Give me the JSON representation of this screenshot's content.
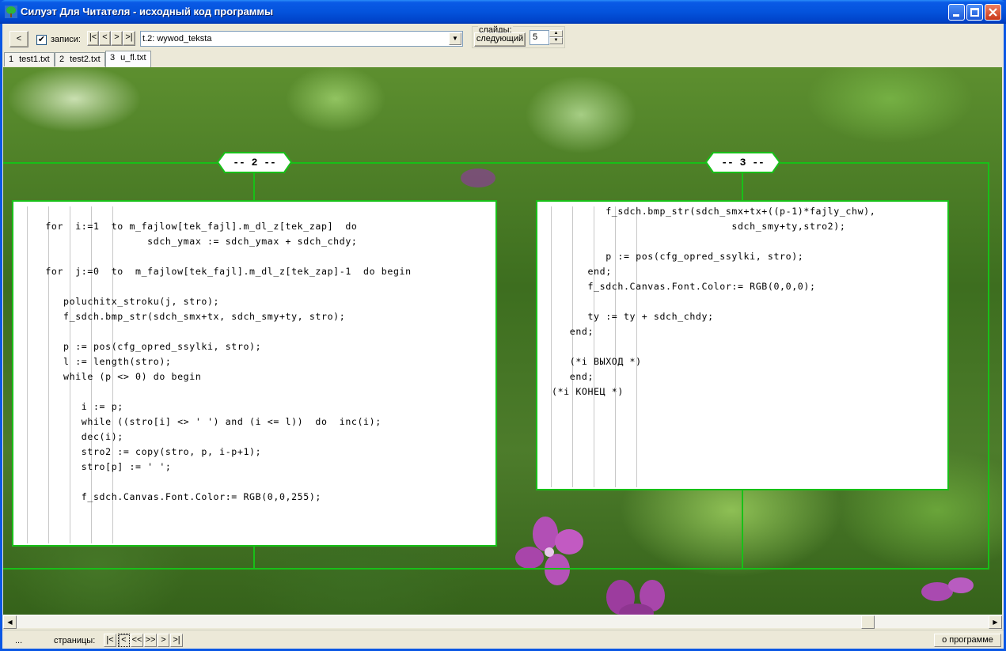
{
  "window": {
    "title": "Силуэт Для Читателя  -  исходный код программы",
    "icon": "tree-icon"
  },
  "toolbar": {
    "back_label": "<",
    "records_checked": true,
    "records_label": "записи:",
    "nav_first": "|<",
    "nav_prev": "<",
    "nav_next": ">",
    "nav_last": ">|",
    "record_select_value": "t.2: wywod_teksta",
    "slides_group_label": "слайды:",
    "slides_next_label": "следующий",
    "slides_count": "5"
  },
  "tabs": [
    {
      "num": "1",
      "label": "test1.txt",
      "active": false
    },
    {
      "num": "2",
      "label": "test2.txt",
      "active": false
    },
    {
      "num": "3",
      "label": "u_fl.txt",
      "active": true
    }
  ],
  "pages": [
    {
      "badge": "-- 2 --",
      "lines": [
        "",
        "    for  i:=1  to m_fajlow[tek_fajl].m_dl_z[tek_zap]  do",
        "                     sdch_ymax := sdch_ymax + sdch_chdy;",
        "",
        "    for  j:=0  to  m_fajlow[tek_fajl].m_dl_z[tek_zap]-1  do begin",
        "",
        "       poluchitx_stroku(j, stro);",
        "       f_sdch.bmp_str(sdch_smx+tx, sdch_smy+ty, stro);",
        "",
        "       p := pos(cfg_opred_ssylki, stro);",
        "       l := length(stro);",
        "       while (p <> 0) do begin",
        "",
        "          i := p;",
        "          while ((stro[i] <> ' ') and (i <= l))  do  inc(i);",
        "          dec(i);",
        "          stro2 := copy(stro, p, i-p+1);",
        "          stro[p] := ' ';",
        "",
        "          f_sdch.Canvas.Font.Color:= RGB(0,0,255);"
      ]
    },
    {
      "badge": "-- 3 --",
      "lines": [
        "         f_sdch.bmp_str(sdch_smx+tx+((p-1)*fajly_chw),",
        "                              sdch_smy+ty,stro2);",
        "",
        "         p := pos(cfg_opred_ssylki, stro);",
        "      end;",
        "      f_sdch.Canvas.Font.Color:= RGB(0,0,0);",
        "",
        "      ty := ty + sdch_chdy;",
        "   end;",
        "",
        "   (*i ВЫХОД *)",
        "   end;",
        "(*i КОНЕЦ *)"
      ]
    }
  ],
  "status": {
    "dots": "...",
    "pages_label": "страницы:",
    "buttons": [
      "|<",
      "<",
      "<<",
      ">>",
      ">",
      ">|"
    ],
    "about_label": "о программе"
  },
  "colors": {
    "frame_green": "#18c018",
    "titlebar_blue": "#0453dc",
    "window_face": "#ece9d8"
  }
}
